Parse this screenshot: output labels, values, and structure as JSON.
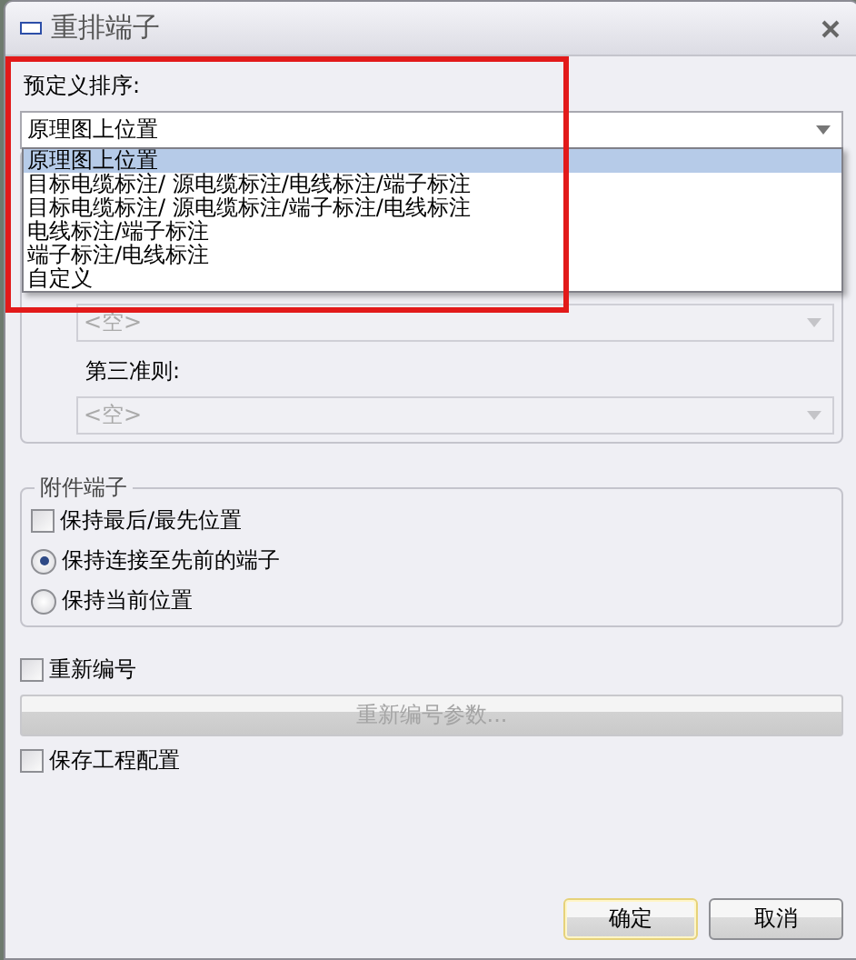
{
  "window": {
    "title": "重排端子"
  },
  "predefined_sort": {
    "label": "预定义排序:",
    "value": "原理图上位置",
    "expanded": true,
    "options": [
      {
        "label": "原理图上位置",
        "selected": true
      },
      {
        "label": "目标电缆标注/ 源电缆标注/电线标注/端子标注",
        "selected": false
      },
      {
        "label": "目标电缆标注/ 源电缆标注/端子标注/电线标注",
        "selected": false
      },
      {
        "label": "电线标注/端子标注",
        "selected": false
      },
      {
        "label": "端子标注/电线标注",
        "selected": false
      },
      {
        "label": "自定义",
        "selected": false
      }
    ]
  },
  "second_rule": {
    "value": "<空>",
    "disabled": true
  },
  "third_rule": {
    "label": "第三准则:",
    "value": "<空>",
    "disabled": true
  },
  "accessory_terminals": {
    "title": "附件端子",
    "options": [
      {
        "kind": "checkbox",
        "label": "保持最后/最先位置",
        "checked": false
      },
      {
        "kind": "radio",
        "label": "保持连接至先前的端子",
        "selected": true
      },
      {
        "kind": "radio",
        "label": "保持当前位置",
        "selected": false
      }
    ]
  },
  "renumber": {
    "label": "重新编号",
    "checked": false
  },
  "renumber_params_button": {
    "label": "重新编号参数...",
    "disabled": true
  },
  "save_project_config": {
    "label": "保存工程配置",
    "checked": false
  },
  "buttons": [
    {
      "label": "确定",
      "default": true
    },
    {
      "label": "取消",
      "default": false
    }
  ]
}
